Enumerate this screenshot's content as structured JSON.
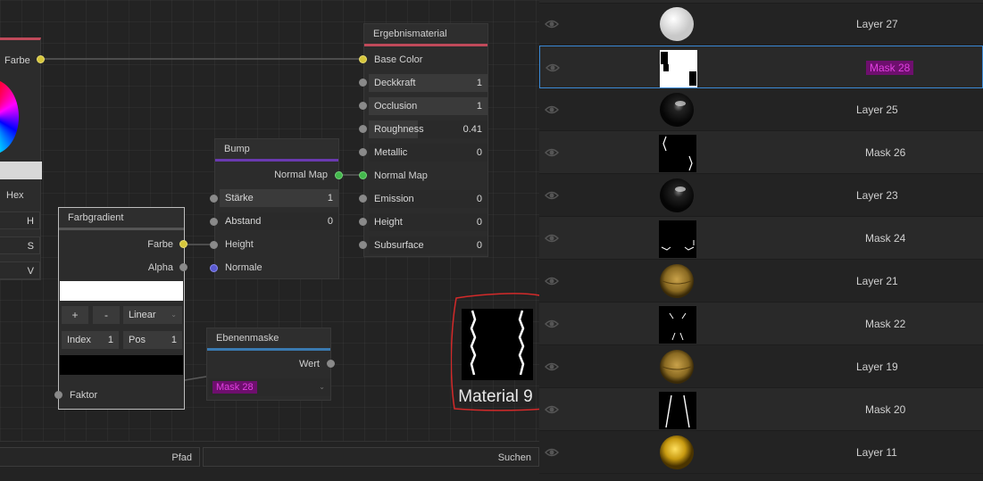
{
  "color_node": {
    "output_label": "Farbe",
    "hex_label": "Hex",
    "channel_h": "H",
    "channel_s": "S",
    "channel_v": "V"
  },
  "result_node": {
    "title": "Ergebnismaterial",
    "base_color": "Base Color",
    "deckkraft": {
      "label": "Deckkraft",
      "value": "1"
    },
    "occlusion": {
      "label": "Occlusion",
      "value": "1"
    },
    "roughness": {
      "label": "Roughness",
      "value": "0.41",
      "fill": 0.41
    },
    "metallic": {
      "label": "Metallic",
      "value": "0"
    },
    "normal_map": "Normal Map",
    "emission": {
      "label": "Emission",
      "value": "0"
    },
    "height": {
      "label": "Height",
      "value": "0"
    },
    "subsurface": {
      "label": "Subsurface",
      "value": "0"
    }
  },
  "bump_node": {
    "title": "Bump",
    "output_label": "Normal Map",
    "staerke": {
      "label": "Stärke",
      "value": "1"
    },
    "abstand": {
      "label": "Abstand",
      "value": "0"
    },
    "height_label": "Height",
    "normale_label": "Normale"
  },
  "gradient_node": {
    "title": "Farbgradient",
    "farbe_label": "Farbe",
    "alpha_label": "Alpha",
    "plus_label": "+",
    "minus_label": "-",
    "interp": "Linear",
    "index_label": "Index",
    "index_value": "1",
    "pos_label": "Pos",
    "pos_value": "1",
    "faktor_label": "Faktor"
  },
  "mask_node": {
    "title": "Ebenenmaske",
    "wert_label": "Wert",
    "selected_mask": "Mask 28"
  },
  "preview": {
    "label": "Material 9"
  },
  "bottom_bar": {
    "path_label": "Pfad",
    "search_label": "Suchen"
  },
  "layers": [
    {
      "name": "Layer 27",
      "thumb": "white-sphere"
    },
    {
      "name": "Mask 28",
      "thumb": "mask-white",
      "selected": true
    },
    {
      "name": "Layer 25",
      "thumb": "dark-sphere"
    },
    {
      "name": "Mask 26",
      "thumb": "mask-lines"
    },
    {
      "name": "Layer 23",
      "thumb": "dark-sphere"
    },
    {
      "name": "Mask 24",
      "thumb": "mask-dots"
    },
    {
      "name": "Layer 21",
      "thumb": "gold-sphere"
    },
    {
      "name": "Mask 22",
      "thumb": "mask-legs"
    },
    {
      "name": "Layer 19",
      "thumb": "gold-sphere"
    },
    {
      "name": "Mask 20",
      "thumb": "mask-stripes"
    },
    {
      "name": "Layer 11",
      "thumb": "yellow-sphere"
    }
  ],
  "icons": {
    "visibility": "eye-icon",
    "dropdown": "chevron-down-icon"
  }
}
